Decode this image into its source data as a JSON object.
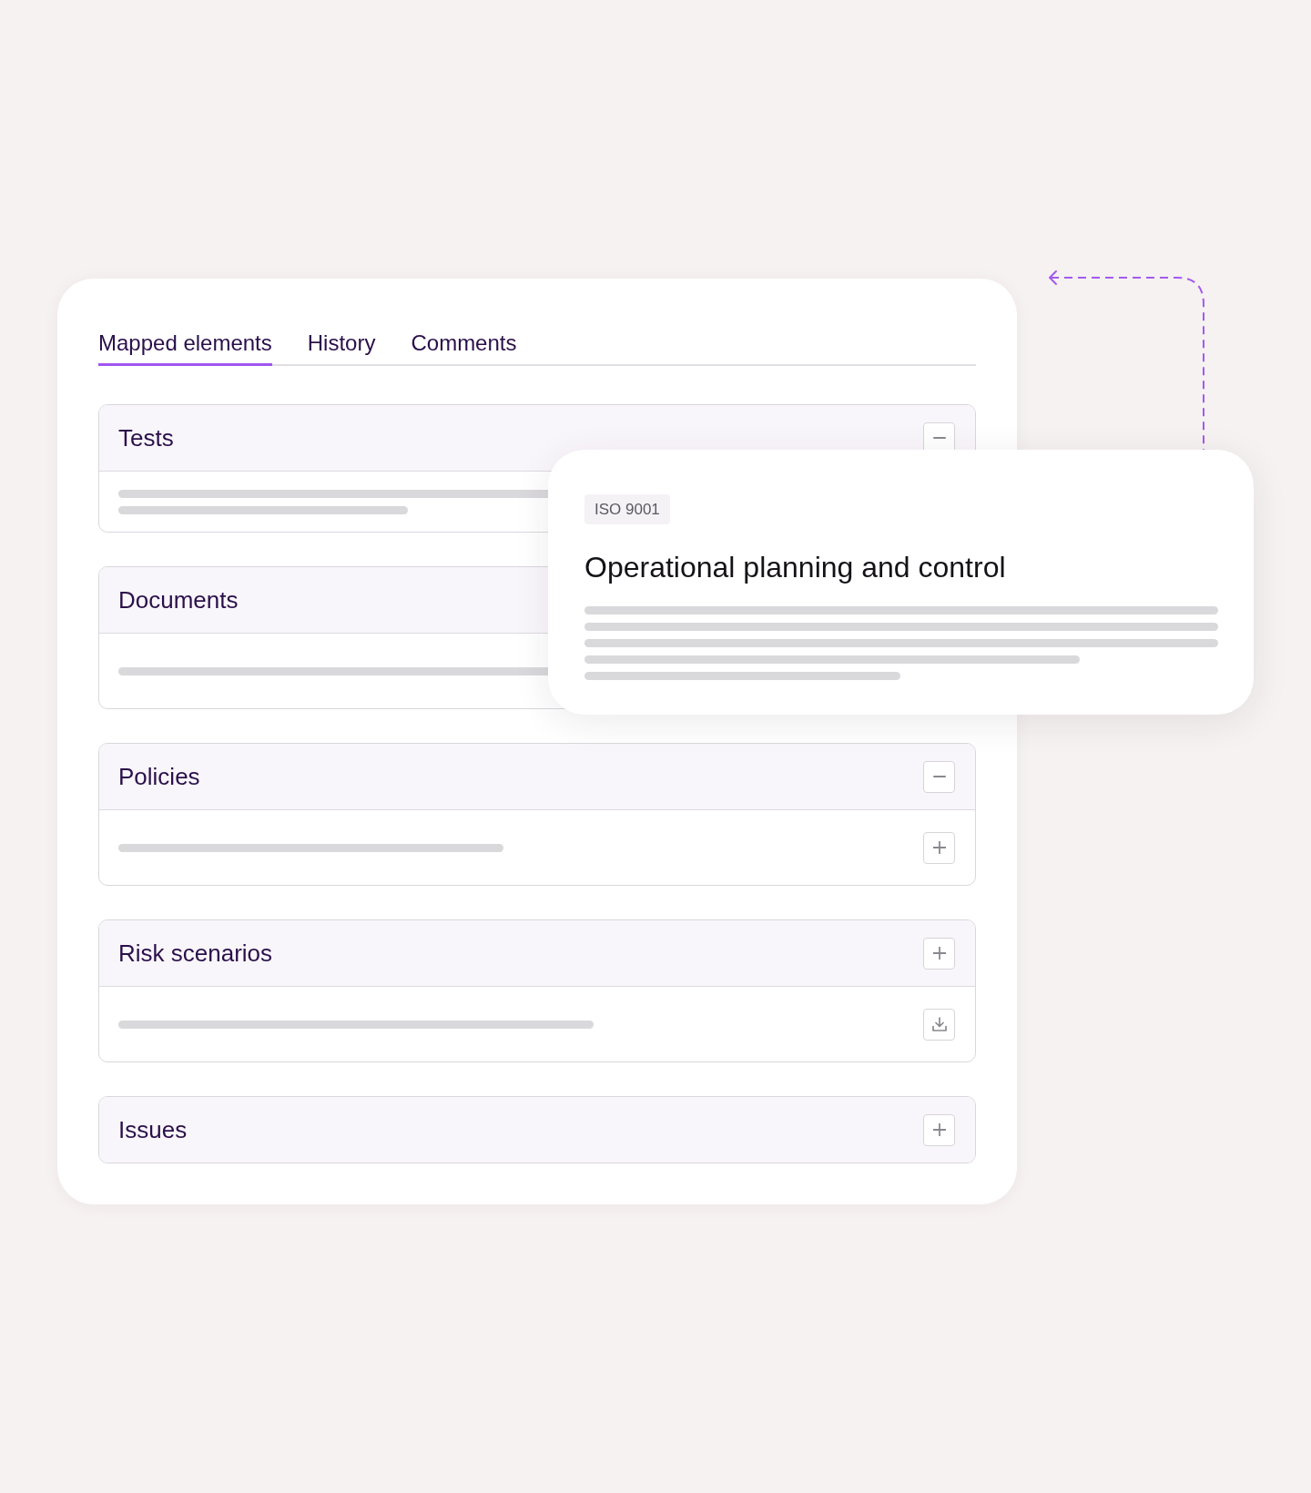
{
  "tabs": [
    {
      "label": "Mapped elements",
      "selected": true
    },
    {
      "label": "History",
      "selected": false
    },
    {
      "label": "Comments",
      "selected": false
    }
  ],
  "sections": [
    {
      "title": "Tests",
      "expanded": true
    },
    {
      "title": "Documents",
      "expanded": true
    },
    {
      "title": "Policies",
      "expanded": true
    },
    {
      "title": "Risk scenarios",
      "expanded": true
    },
    {
      "title": "Issues",
      "expanded": false
    }
  ],
  "popup": {
    "badge": "ISO 9001",
    "title": "Operational planning and control"
  }
}
